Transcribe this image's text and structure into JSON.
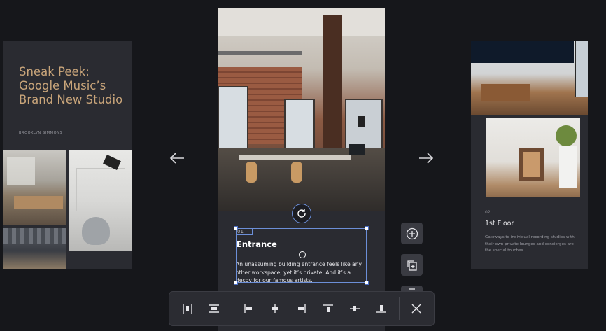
{
  "left_card": {
    "title": "Sneak Peek: Google Music’s Brand New Studio",
    "author": "BROOKLYN SIMMONS"
  },
  "center_card": {
    "index": "01",
    "heading": "Entrance",
    "body": "An unassuming building entrance feels like any other workspace, yet it’s private. And it’s a decoy for our famous artists."
  },
  "right_card": {
    "index": "02",
    "heading": "1st Floor",
    "description": "Gateways to individual recording studios with their own private lounges and concierges are the special touches."
  },
  "navigation": {
    "prev_icon": "arrow-left-icon",
    "next_icon": "arrow-right-icon"
  },
  "side_actions": [
    "add-icon",
    "duplicate-icon",
    "delete-icon"
  ],
  "toolbar": {
    "tools": [
      "distribute-horizontal-icon",
      "distribute-vertical-icon",
      "align-left-icon",
      "align-center-horizontal-icon",
      "align-right-icon",
      "align-top-icon",
      "align-middle-vertical-icon",
      "align-bottom-icon"
    ],
    "close_icon": "close-icon"
  },
  "colors": {
    "background": "#16171b",
    "card": "#2a2b31",
    "accent_title": "#c9a57a",
    "selection": "#6c8fd8"
  }
}
